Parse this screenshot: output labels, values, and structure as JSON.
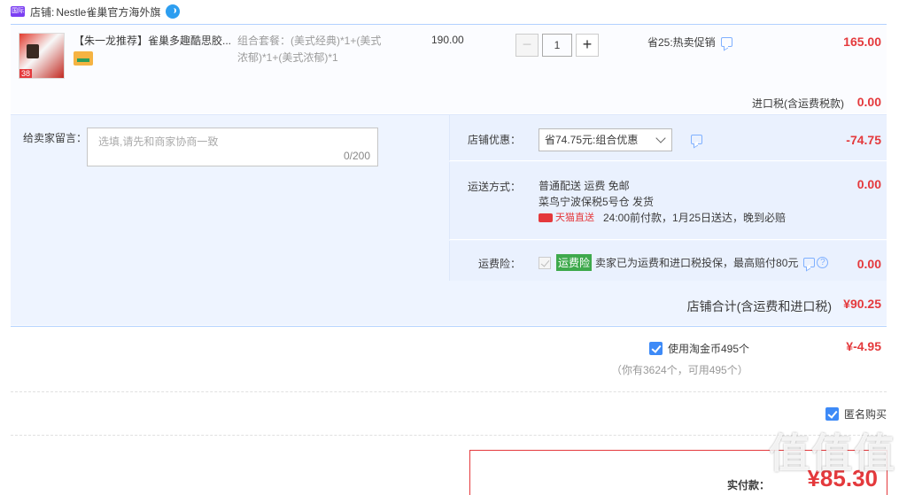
{
  "shop": {
    "icon_text": "国际",
    "label": "店铺:",
    "name": "Nestle雀巢官方海外旗"
  },
  "item": {
    "title": "【朱一龙推荐】雀巢多趣酷思胶...",
    "sku_line1": "组合套餐：(美式经典)*1+(美式",
    "sku_line2": "浓郁)*1+(美式浓郁)*1",
    "price": "190.00",
    "qty_minus": "−",
    "qty": "1",
    "qty_plus": "+",
    "promo": "省25:热卖促销",
    "subtotal": "165.00",
    "tax_label": "进口税(含运费税款)",
    "tax_value": "0.00"
  },
  "message": {
    "label": "给卖家留言：",
    "placeholder": "选填,请先和商家协商一致",
    "count": "0/200"
  },
  "coupon": {
    "label": "店铺优惠：",
    "selected": "省74.75元:组合优惠",
    "value": "-74.75"
  },
  "shipping": {
    "label": "运送方式：",
    "line1": "普通配送 运费 免邮",
    "line2": "菜鸟宁波保税5号仓  发货",
    "tmall_text": "天猫直送",
    "line3": "24:00前付款，1月25日送达，晚到必赔",
    "value": "0.00"
  },
  "insurance": {
    "label": "运费险：",
    "badge": "运费险",
    "text": "卖家已为运费和进口税投保，最高赔付80元",
    "q": "?",
    "value": "0.00"
  },
  "shop_total": {
    "label": "店铺合计(含运费和进口税)",
    "value": "¥90.25"
  },
  "coins": {
    "label": "使用淘金币495个",
    "note": "（你有3624个，可用495个）",
    "value": "¥-4.95"
  },
  "anonymous": {
    "label": "匿名购买"
  },
  "payment": {
    "label": "实付款：",
    "value": "¥85.30"
  },
  "watermark": "值值值",
  "colors": {
    "accent_red": "#e4393c",
    "blue_check": "#3d8af7",
    "panel_bg": "#eef4ff"
  }
}
